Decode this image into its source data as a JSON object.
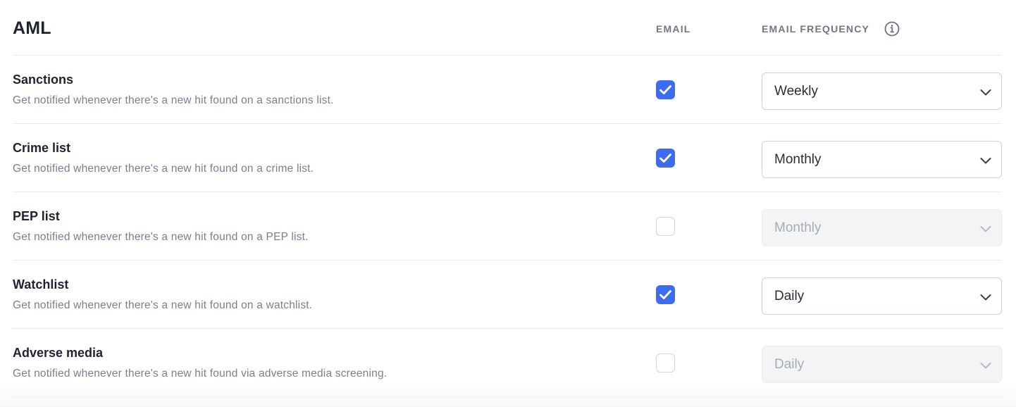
{
  "section": {
    "title": "AML",
    "email_column": "EMAIL",
    "frequency_column": "EMAIL FREQUENCY",
    "info_icon": "info-circle-icon"
  },
  "rows": [
    {
      "title": "Sanctions",
      "description": "Get notified whenever there's a new hit found on a sanctions list.",
      "email_checked": true,
      "frequency": "Weekly",
      "frequency_enabled": true
    },
    {
      "title": "Crime list",
      "description": "Get notified whenever there's a new hit found on a crime list.",
      "email_checked": true,
      "frequency": "Monthly",
      "frequency_enabled": true
    },
    {
      "title": "PEP list",
      "description": "Get notified whenever there's a new hit found on a PEP list.",
      "email_checked": false,
      "frequency": "Monthly",
      "frequency_enabled": false
    },
    {
      "title": "Watchlist",
      "description": "Get notified whenever there's a new hit found on a watchlist.",
      "email_checked": true,
      "frequency": "Daily",
      "frequency_enabled": true
    },
    {
      "title": "Adverse media",
      "description": "Get notified whenever there's a new hit found via adverse media screening.",
      "email_checked": false,
      "frequency": "Daily",
      "frequency_enabled": false
    }
  ],
  "colors": {
    "accent": "#3b6cf2",
    "border": "#e8eaee",
    "muted_text": "#7a8090"
  }
}
